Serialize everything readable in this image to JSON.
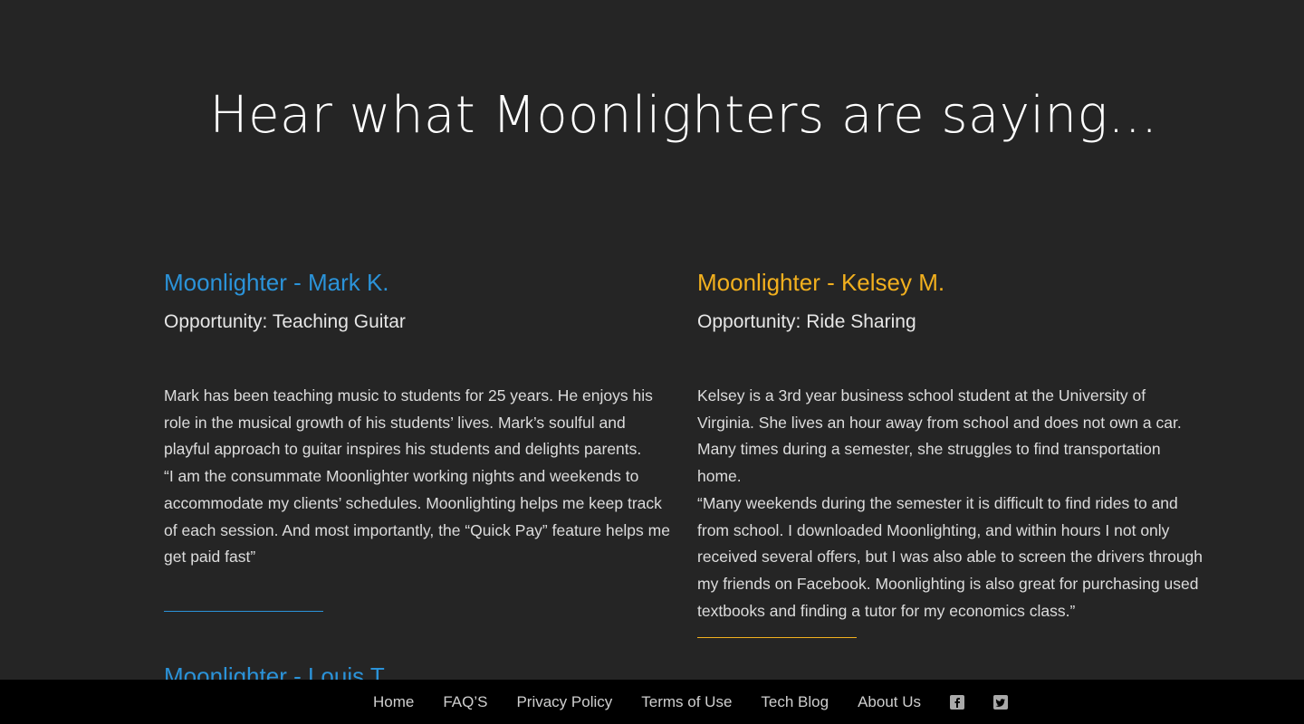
{
  "headline": "Hear what Moonlighters are saying...",
  "testimonials": [
    {
      "title": "Moonlighter - Mark K.",
      "opportunity": "Opportunity: Teaching Guitar",
      "bio": "Mark has been teaching music to students for 25 years. He enjoys his role in the musical growth of his students’ lives. Mark’s soulful and playful approach to guitar inspires his students and delights parents.",
      "quote": "“I am the consummate Moonlighter working nights and weekends to accommodate my clients’ schedules. Moonlighting helps me keep track of each session. And most importantly, the “Quick Pay” feature helps me get paid fast”",
      "accent": "#2b93d9"
    },
    {
      "title": "Moonlighter - Kelsey M.",
      "opportunity": "Opportunity: Ride Sharing",
      "bio": "Kelsey is a 3rd year business school student at the University of Virginia. She lives an hour away from school and does not own a car. Many times during a semester, she struggles to find transportation home.",
      "quote": "“Many weekends during the semester it is difficult to find rides to and from school. I downloaded Moonlighting, and within hours I not only received several offers, but I was also able to screen the drivers through my friends on Facebook. Moonlighting is also great for purchasing used textbooks and finding a tutor for my economics class.”",
      "accent": "#f2b01e"
    },
    {
      "title": "Moonlighter - Louis T."
    }
  ],
  "footer": {
    "links": [
      "Home",
      "FAQ’S",
      "Privacy Policy",
      "Terms of Use",
      "Tech Blog",
      "About Us"
    ],
    "social": [
      {
        "icon": "facebook-icon"
      },
      {
        "icon": "twitter-icon"
      }
    ]
  },
  "colors": {
    "background": "#252525",
    "footer_background": "#000000",
    "blue_accent": "#2b93d9",
    "gold_accent": "#f2b01e"
  }
}
